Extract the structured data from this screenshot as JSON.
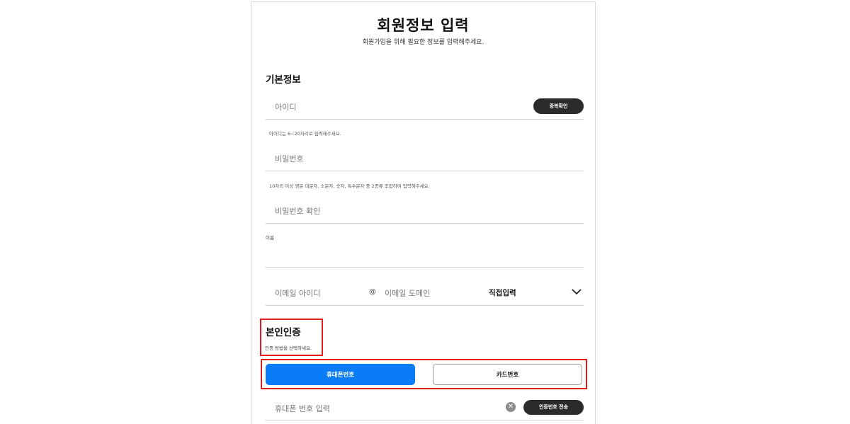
{
  "header": {
    "title": "회원정보 입력",
    "subtitle": "회원가입을 위해 필요한 정보를 입력해주세요."
  },
  "basic_info": {
    "section_title": "기본정보",
    "id_placeholder": "아이디",
    "id_check_button": "중복확인",
    "id_hint": "아이디는 6~20자리로 입력해주세요.",
    "password_placeholder": "비밀번호",
    "password_hint": "10자리 이상 영문 대문자, 소문자, 숫자, 특수문자 중 2종류 조합하여 입력해주세요.",
    "password_confirm_placeholder": "비밀번호 확인",
    "name_label": "이름",
    "email_id_placeholder": "이메일 아이디",
    "email_at": "@",
    "email_domain_placeholder": "이메일 도메인",
    "email_domain_select": "직접입력"
  },
  "verification": {
    "section_title": "본인인증",
    "subtitle": "인증 방법을 선택하세요.",
    "method_phone": "휴대폰번호",
    "method_card": "카드번호",
    "phone_placeholder": "휴대폰 번호 입력",
    "send_code_button": "인증번호 전송"
  },
  "colors": {
    "accent": "#0a7cf6",
    "highlight": "#e31b1b",
    "dark_button": "#2b2b2b"
  }
}
